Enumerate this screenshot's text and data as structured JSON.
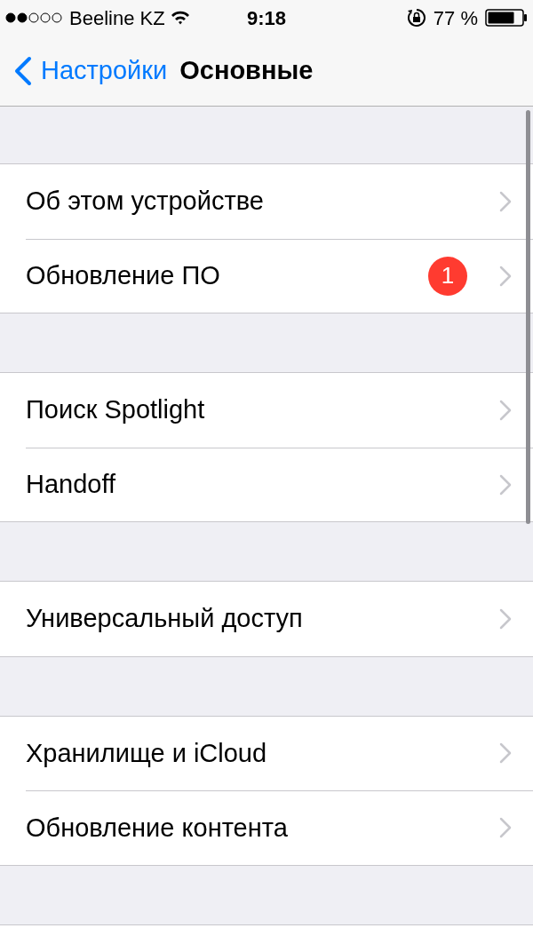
{
  "status_bar": {
    "carrier": "Beeline KZ",
    "time": "9:18",
    "battery": "77 %"
  },
  "nav": {
    "back": "Настройки",
    "title": "Основные"
  },
  "groups": [
    {
      "rows": [
        {
          "label": "Об этом устройстве"
        },
        {
          "label": "Обновление ПО",
          "badge": "1"
        }
      ]
    },
    {
      "rows": [
        {
          "label": "Поиск Spotlight"
        },
        {
          "label": "Handoff"
        }
      ]
    },
    {
      "rows": [
        {
          "label": "Универсальный доступ"
        }
      ]
    },
    {
      "rows": [
        {
          "label": "Хранилище и iCloud"
        },
        {
          "label": "Обновление контента"
        }
      ]
    }
  ]
}
